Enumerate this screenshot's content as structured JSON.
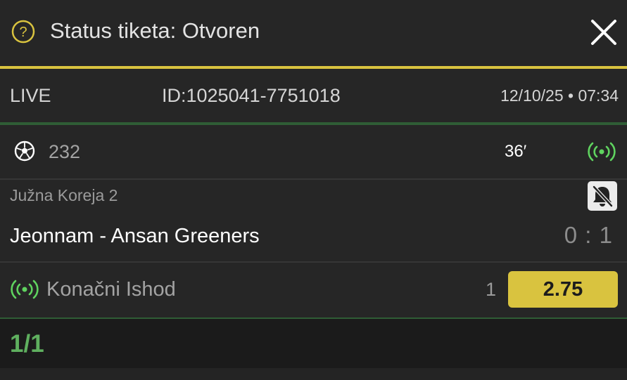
{
  "header": {
    "title": "Status tiketa: Otvoren",
    "help_icon": "question-circle-icon",
    "close_icon": "close-icon",
    "accent_color": "#d9c33f"
  },
  "ticket": {
    "type": "LIVE",
    "id": "ID:1025041-7751018",
    "datetime": "12/10/25 • 07:34"
  },
  "event": {
    "sport_icon": "soccer-ball-icon",
    "code": "232",
    "minute": "36′",
    "live_icon": "live-broadcast-icon",
    "league": "Južna Koreja 2",
    "notification_icon": "bell-off-icon",
    "match": "Jeonnam - Ansan Greeners",
    "score": "0 : 1",
    "live_color": "#5fd35f"
  },
  "bet": {
    "market": "Konačni Ishod",
    "pick": "1",
    "odds": "2.75"
  },
  "footer": {
    "count": "1/1",
    "count_color": "#5fb05f"
  }
}
